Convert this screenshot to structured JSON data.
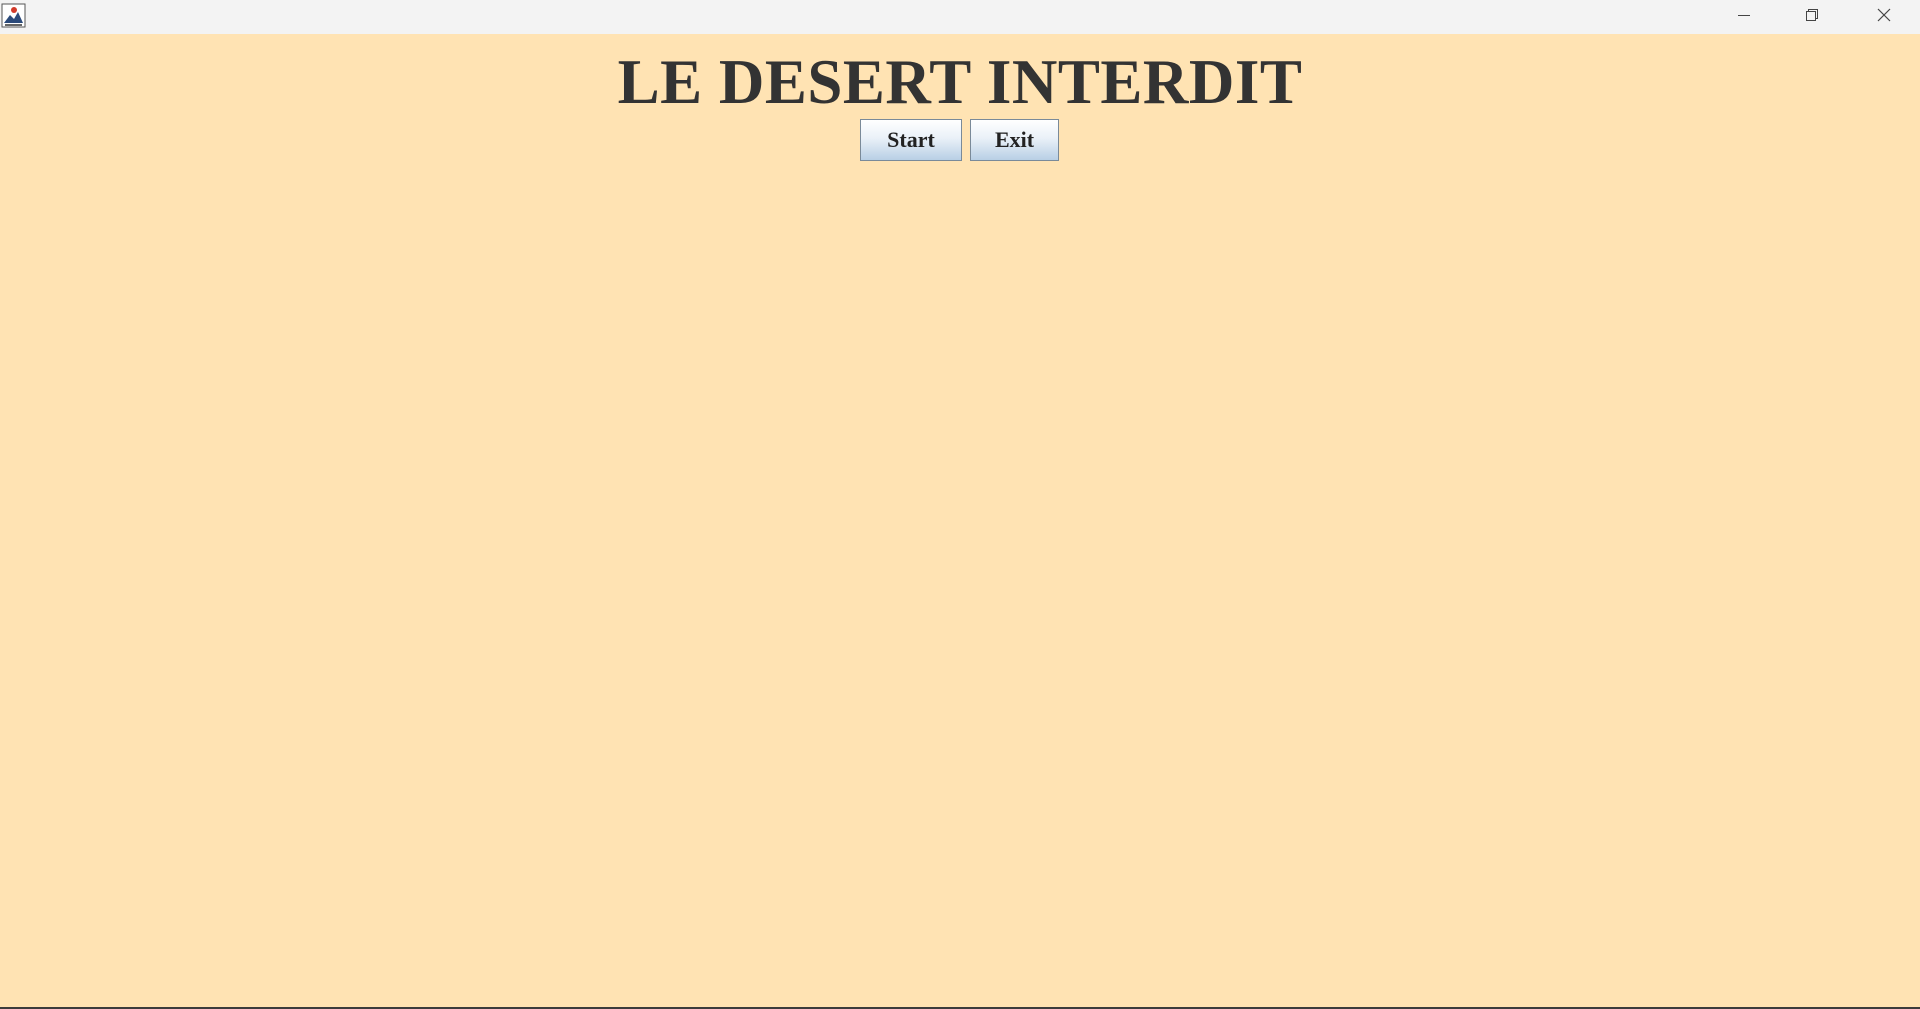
{
  "window": {
    "background_color": "#ffe3b3",
    "titlebar_color": "#f3f3f3",
    "icons": {
      "app": "java-app-icon",
      "minimize": "minimize-icon",
      "maximize": "restore-icon",
      "close": "close-icon"
    }
  },
  "main": {
    "title": "LE DESERT INTERDIT",
    "title_color": "#333333",
    "buttons": {
      "start_label": "Start",
      "exit_label": "Exit"
    }
  }
}
